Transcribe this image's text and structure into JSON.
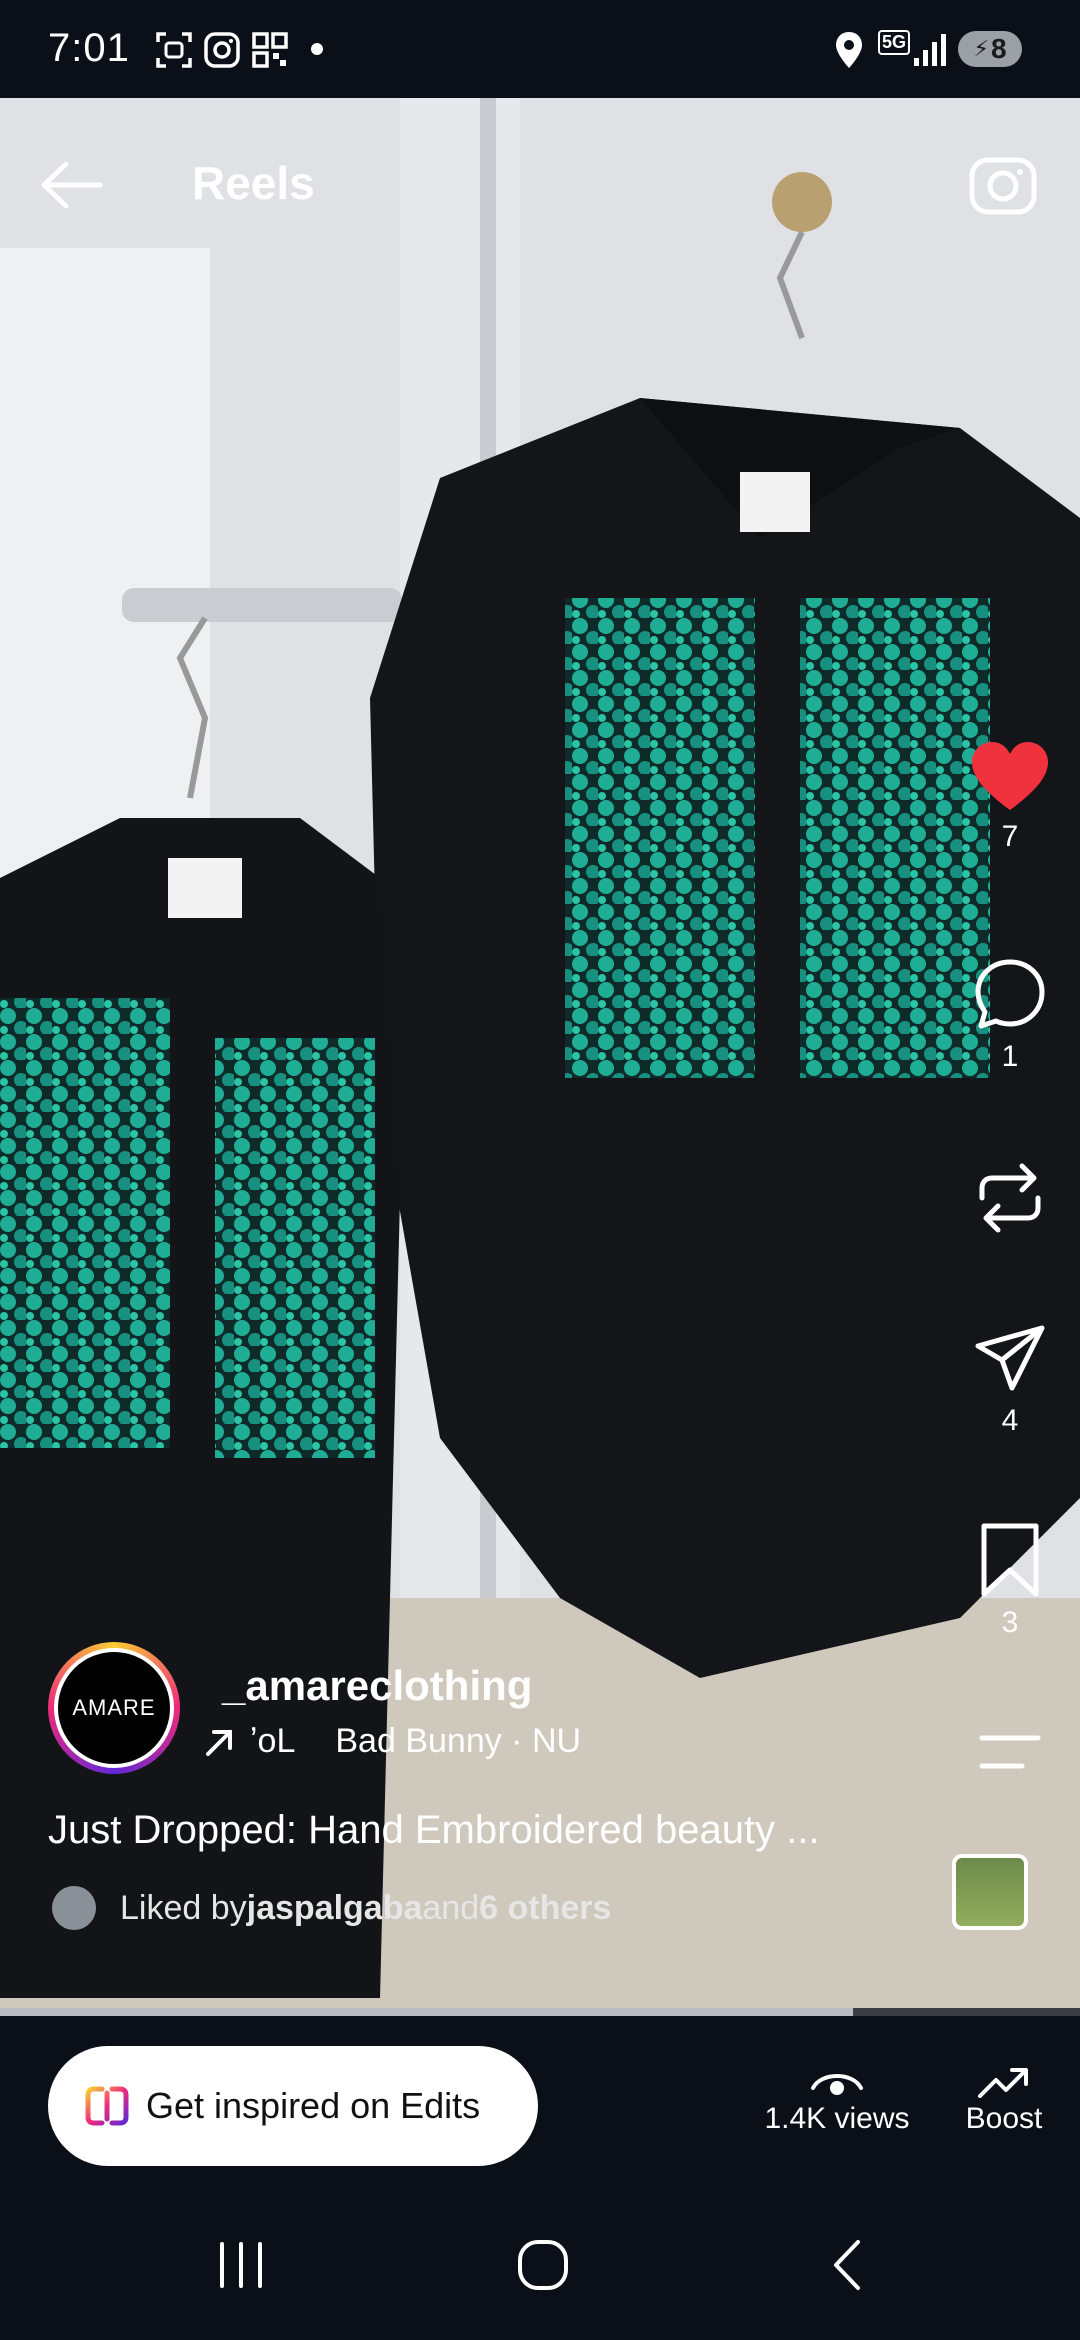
{
  "status_bar": {
    "time": "7:01",
    "battery": "8",
    "network": "5G"
  },
  "header": {
    "title": "Reels"
  },
  "actions": {
    "likes": "7",
    "comments": "1",
    "shares": "4",
    "saves": "3"
  },
  "post": {
    "username": "_amareclothing",
    "avatar_text": "AMARE",
    "audio_prefix": "ʼoL",
    "audio": "Bad Bunny · NU",
    "caption": "Just Dropped: Hand Embroidered beauty ...",
    "liked_prefix": "Liked by ",
    "liked_user": "jaspalgaba",
    "liked_and": " and ",
    "liked_others": "6 others",
    "progress": 0.79
  },
  "bottom_bar": {
    "edits_label": "Get inspired on Edits",
    "views_label": "1.4K views",
    "boost_label": "Boost"
  },
  "colors": {
    "like_red": "#f0323f",
    "background": "#0b0f17"
  }
}
